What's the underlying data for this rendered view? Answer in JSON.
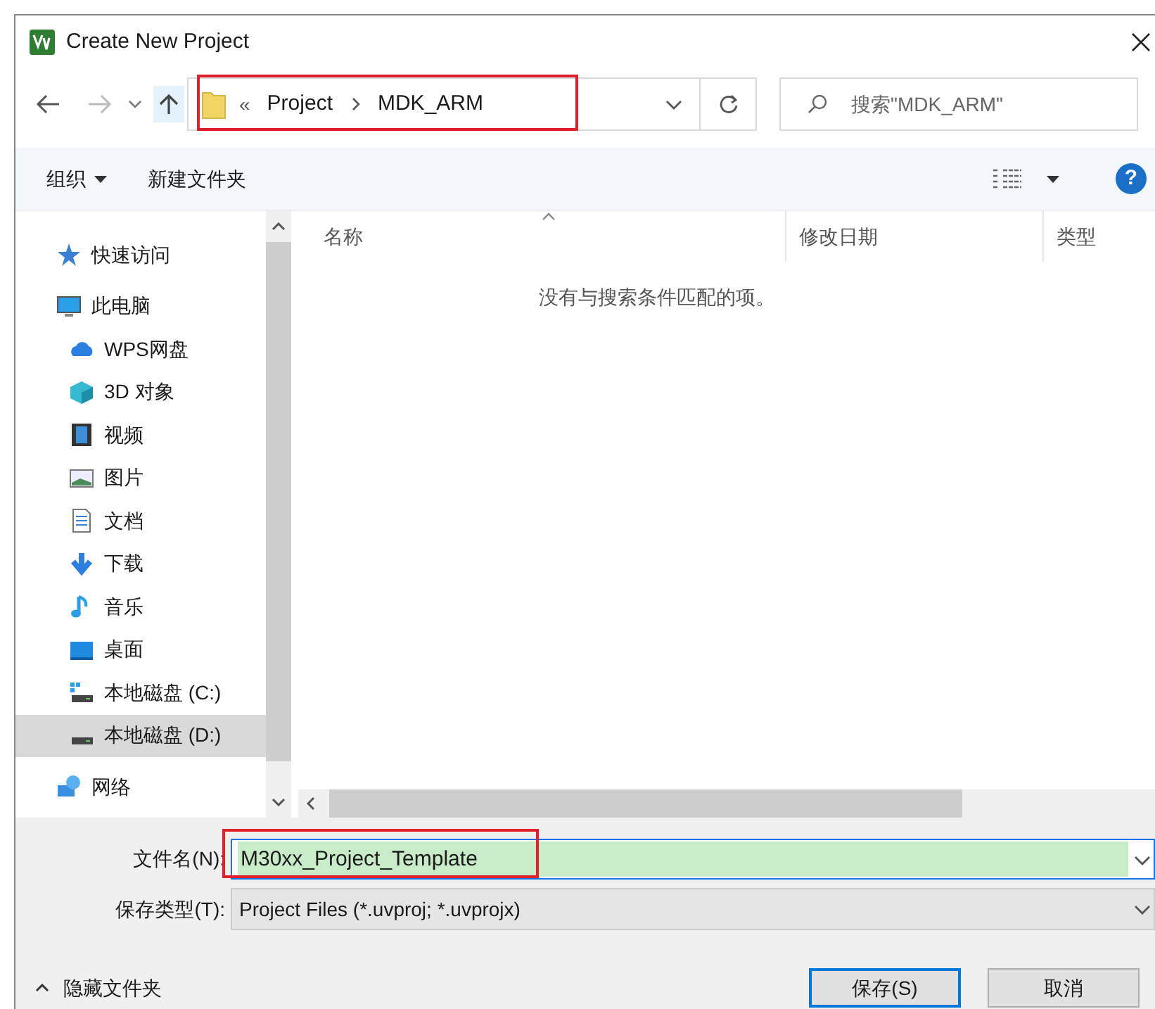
{
  "window": {
    "title": "Create New Project"
  },
  "nav": {
    "overflow": "«",
    "path": [
      {
        "label": "Project"
      },
      {
        "label": "MDK_ARM"
      }
    ],
    "highlighted": true,
    "search": {
      "placeholder": "搜索\"MDK_ARM\""
    }
  },
  "toolbar": {
    "organize": "组织",
    "new_folder": "新建文件夹",
    "help": "?"
  },
  "sidebar": {
    "items": [
      {
        "label": "快速访问",
        "kind": "star",
        "selected": false
      },
      {
        "label": "此电脑",
        "kind": "computer",
        "selected": false,
        "children": [
          {
            "label": "WPS网盘",
            "kind": "cloud",
            "selected": false
          },
          {
            "label": "3D 对象",
            "kind": "cube",
            "selected": false
          },
          {
            "label": "视频",
            "kind": "film",
            "selected": false
          },
          {
            "label": "图片",
            "kind": "image",
            "selected": false
          },
          {
            "label": "文档",
            "kind": "document",
            "selected": false
          },
          {
            "label": "下载",
            "kind": "download",
            "selected": false
          },
          {
            "label": "音乐",
            "kind": "music",
            "selected": false
          },
          {
            "label": "桌面",
            "kind": "desktop",
            "selected": false
          },
          {
            "label": "本地磁盘 (C:)",
            "kind": "systemdrive",
            "selected": false
          },
          {
            "label": "本地磁盘 (D:)",
            "kind": "drive",
            "selected": true
          }
        ]
      },
      {
        "label": "网络",
        "kind": "network",
        "selected": false
      }
    ]
  },
  "table": {
    "columns": [
      {
        "label": "名称",
        "sorted": true
      },
      {
        "label": "修改日期",
        "sorted": false
      },
      {
        "label": "类型",
        "sorted": false
      }
    ],
    "empty_message": "没有与搜索条件匹配的项。"
  },
  "filename": {
    "label": "文件名(N):",
    "value": "M30xx_Project_Template",
    "highlighted": true
  },
  "filetype": {
    "label": "保存类型(T):",
    "value": "Project Files (*.uvproj; *.uvprojx)"
  },
  "hide_folders": "隐藏文件夹",
  "buttons": [
    {
      "label": "保存(S)",
      "default": true
    },
    {
      "label": "取消",
      "default": false
    }
  ]
}
